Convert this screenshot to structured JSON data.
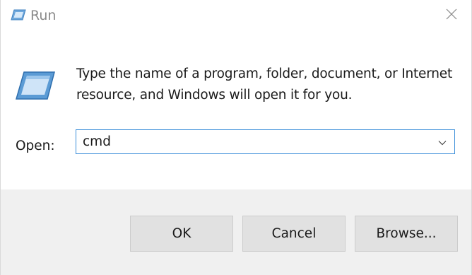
{
  "window": {
    "title": "Run",
    "title_icon": "run-icon",
    "close_icon": "close-icon"
  },
  "content": {
    "icon": "run-icon",
    "message_line1": "Type the name of a program, folder, document, or Internet",
    "message_line2": "resource, and Windows will open it for you.",
    "open_label": "Open:",
    "open_value": "cmd",
    "dropdown_icon": "chevron-down-icon"
  },
  "buttons": {
    "ok_label": "OK",
    "cancel_label": "Cancel",
    "browse_label": "Browse..."
  },
  "colors": {
    "accent_border": "#3b8ed9",
    "footer_background": "#f0f0f0",
    "button_background": "#e1e1e1"
  }
}
